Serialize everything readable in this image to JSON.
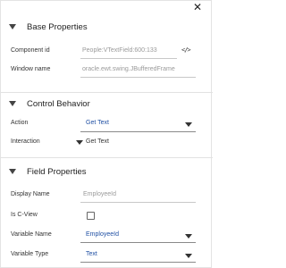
{
  "window": {
    "close_icon": "close-icon"
  },
  "sections": {
    "base": {
      "title": "Base Properties",
      "component_id_label": "Component id",
      "component_id_value": "People:VTextField:600:133",
      "window_name_label": "Window name",
      "window_name_value": "oracle.ewt.swing.JBufferedFrame"
    },
    "control": {
      "title": "Control Behavior",
      "action_label": "Action",
      "action_value": "Get Text",
      "interaction_label": "Interaction",
      "interaction_value": "Get Text"
    },
    "field": {
      "title": "Field Properties",
      "display_name_label": "Display Name",
      "display_name_placeholder": "EmployeeId",
      "is_cview_label": "Is C-View",
      "is_cview_checked": false,
      "variable_name_label": "Variable Name",
      "variable_name_value": "EmployeeId",
      "variable_type_label": "Variable Type",
      "variable_type_value": "Text"
    }
  },
  "colors": {
    "link_blue": "#1f4fa3",
    "muted_gray": "#9a9a9a"
  }
}
